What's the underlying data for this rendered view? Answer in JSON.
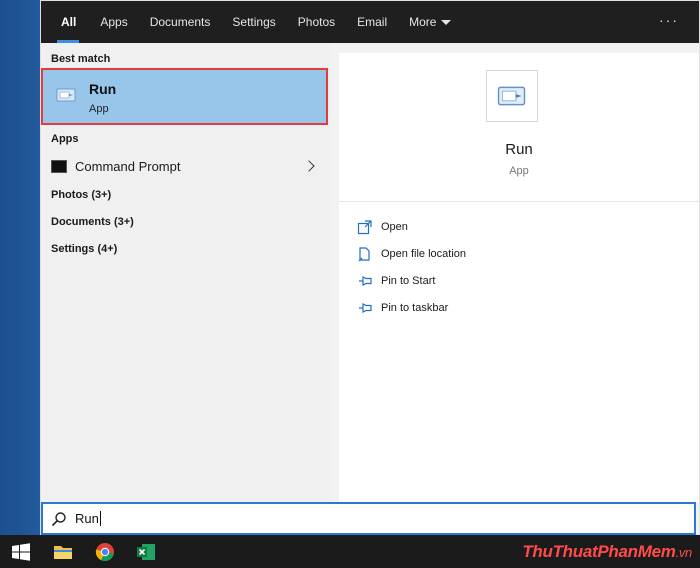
{
  "tabs": [
    {
      "label": "All",
      "active": true
    },
    {
      "label": "Apps"
    },
    {
      "label": "Documents"
    },
    {
      "label": "Settings"
    },
    {
      "label": "Photos"
    },
    {
      "label": "Email"
    },
    {
      "label": "More"
    }
  ],
  "overflow_label": "···",
  "results": {
    "best_match_heading": "Best match",
    "best": {
      "title": "Run",
      "subtitle": "App",
      "icon": "run-icon"
    },
    "apps_heading": "Apps",
    "apps": [
      {
        "label": "Command Prompt",
        "icon": "command-prompt-icon"
      }
    ],
    "categories": [
      "Photos (3+)",
      "Documents (3+)",
      "Settings (4+)"
    ]
  },
  "detail": {
    "title": "Run",
    "subtitle": "App",
    "actions": [
      {
        "label": "Open",
        "icon": "open-icon"
      },
      {
        "label": "Open file location",
        "icon": "file-location-icon"
      },
      {
        "label": "Pin to Start",
        "icon": "pin-icon"
      },
      {
        "label": "Pin to taskbar",
        "icon": "pin-icon"
      }
    ]
  },
  "search": {
    "value": "Run"
  },
  "taskbar": {
    "icons": [
      "windows-start-icon",
      "file-explorer-icon",
      "chrome-icon",
      "excel-icon"
    ]
  },
  "watermark": {
    "brand": "ThuThuatPhanMem",
    "domain": ".vn"
  },
  "colors": {
    "accent": "#2b79d6",
    "selection": "#98c5ea",
    "highlight_border": "#e23c3c",
    "tab_bar": "#1f1f1f"
  }
}
